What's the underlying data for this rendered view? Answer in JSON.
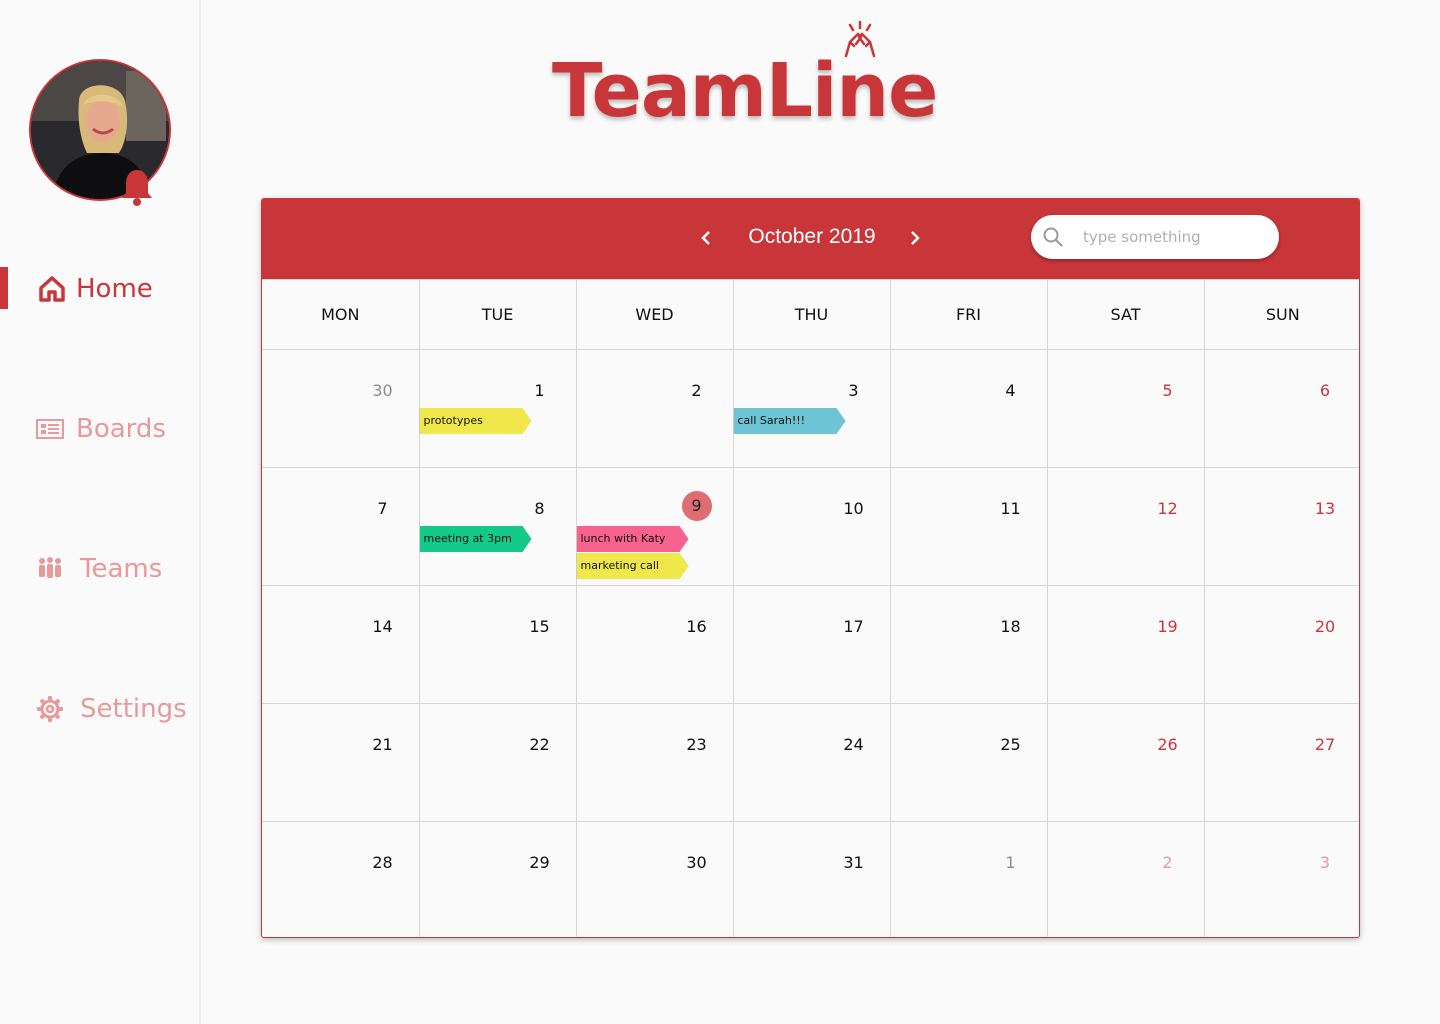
{
  "app": {
    "logo_text": "TeamLine"
  },
  "sidebar": {
    "items": [
      {
        "label": "Home",
        "icon": "home-icon",
        "active": true
      },
      {
        "label": "Boards",
        "icon": "boards-icon",
        "active": false
      },
      {
        "label": "Teams",
        "icon": "teams-icon",
        "active": false
      },
      {
        "label": "Settings",
        "icon": "gear-icon",
        "active": false
      }
    ]
  },
  "calendar": {
    "month_label": "October 2019",
    "search_placeholder": "type something",
    "weekdays": [
      "MON",
      "TUE",
      "WED",
      "THU",
      "FRI",
      "SAT",
      "SUN"
    ],
    "weeks": [
      [
        {
          "day": "30",
          "other": true
        },
        {
          "day": "1",
          "events": [
            {
              "text": "prototypes",
              "color": "#f0e84a"
            }
          ]
        },
        {
          "day": "2"
        },
        {
          "day": "3",
          "events": [
            {
              "text": "call Sarah!!!",
              "color": "#6cc4d4"
            }
          ]
        },
        {
          "day": "4"
        },
        {
          "day": "5",
          "weekend": true
        },
        {
          "day": "6",
          "weekend": true
        }
      ],
      [
        {
          "day": "7"
        },
        {
          "day": "8",
          "events": [
            {
              "text": "meeting at 3pm",
              "color": "#14c98a"
            }
          ]
        },
        {
          "day": "9",
          "today": true,
          "events": [
            {
              "text": "lunch with Katy",
              "color": "#f7628f"
            },
            {
              "text": "marketing call",
              "color": "#f0e84a"
            }
          ]
        },
        {
          "day": "10"
        },
        {
          "day": "11"
        },
        {
          "day": "12",
          "weekend": true
        },
        {
          "day": "13",
          "weekend": true
        }
      ],
      [
        {
          "day": "14"
        },
        {
          "day": "15"
        },
        {
          "day": "16"
        },
        {
          "day": "17"
        },
        {
          "day": "18"
        },
        {
          "day": "19",
          "weekend": true
        },
        {
          "day": "20",
          "weekend": true
        }
      ],
      [
        {
          "day": "21"
        },
        {
          "day": "22"
        },
        {
          "day": "23"
        },
        {
          "day": "24"
        },
        {
          "day": "25"
        },
        {
          "day": "26",
          "weekend": true
        },
        {
          "day": "27",
          "weekend": true
        }
      ],
      [
        {
          "day": "28"
        },
        {
          "day": "29"
        },
        {
          "day": "30"
        },
        {
          "day": "31"
        },
        {
          "day": "1",
          "other": true
        },
        {
          "day": "2",
          "other": true,
          "weekend": true
        },
        {
          "day": "3",
          "other": true,
          "weekend": true
        }
      ]
    ]
  },
  "colors": {
    "accent": "#c9363a",
    "accent_light": "#e79a9c",
    "today_circle": "#de6e72"
  }
}
